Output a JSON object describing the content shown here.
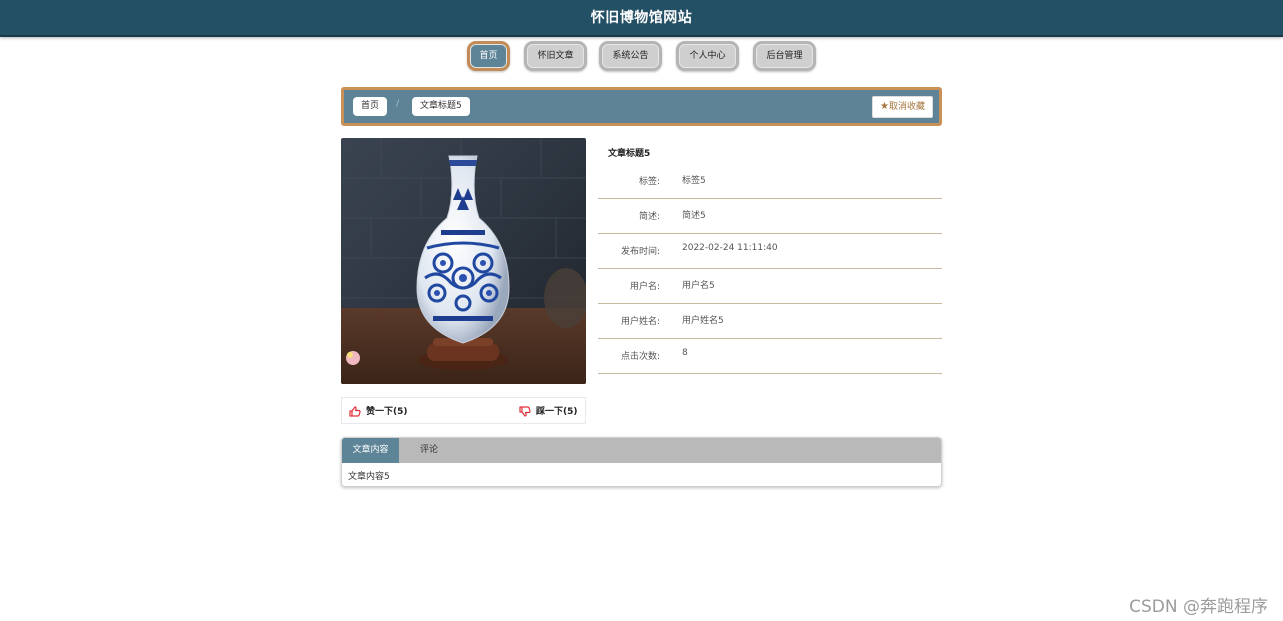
{
  "header": {
    "title": "怀旧博物馆网站"
  },
  "nav": {
    "items": [
      {
        "label": "首页",
        "active": true
      },
      {
        "label": "怀旧文章",
        "active": false
      },
      {
        "label": "系统公告",
        "active": false
      },
      {
        "label": "个人中心",
        "active": false
      },
      {
        "label": "后台管理",
        "active": false
      }
    ]
  },
  "breadcrumb": {
    "home": "首页",
    "separator": "/",
    "current": "文章标题5"
  },
  "favorite": {
    "icon": "star-icon",
    "label": "取消收藏"
  },
  "article": {
    "title": "文章标题5",
    "image": {
      "icon": "vase-photo"
    },
    "fields": [
      {
        "label": "标签:",
        "value": "标签5"
      },
      {
        "label": "简述:",
        "value": "简述5"
      },
      {
        "label": "发布时间:",
        "value": "2022-02-24 11:11:40"
      },
      {
        "label": "用户名:",
        "value": "用户名5"
      },
      {
        "label": "用户姓名:",
        "value": "用户姓名5"
      },
      {
        "label": "点击次数:",
        "value": "8"
      }
    ]
  },
  "votes": {
    "up_label": "赞一下(5)",
    "down_label": "踩一下(5)",
    "up_icon": "thumbs-up-icon",
    "down_icon": "thumbs-down-icon",
    "icon_color": "#e0303a"
  },
  "tabs": {
    "items": [
      {
        "label": "文章内容",
        "active": true
      },
      {
        "label": "评论",
        "active": false
      }
    ],
    "content": "文章内容5"
  },
  "watermark": "CSDN @奔跑程序",
  "colors": {
    "header_bg": "#245066",
    "accent_blue": "#5e8497",
    "accent_border": "#c99058",
    "tab_bar_bg": "#b9b9b9"
  }
}
